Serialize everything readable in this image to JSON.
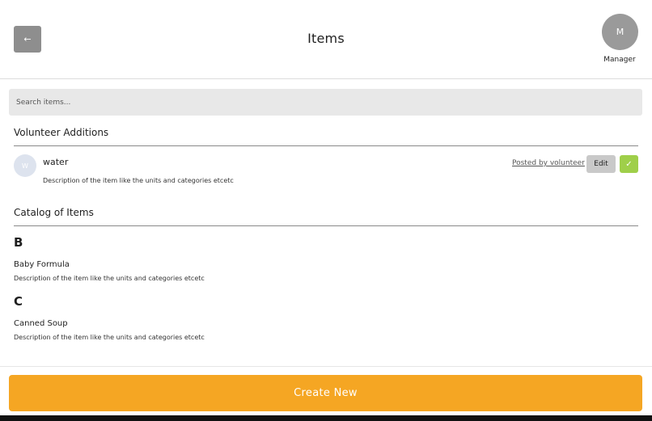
{
  "header": {
    "back_icon": "←",
    "title": "Items",
    "avatar_initial": "M",
    "role_label": "Manager"
  },
  "search": {
    "placeholder": "Search items..."
  },
  "volunteer_section": {
    "title": "Volunteer Additions",
    "items": [
      {
        "avatar_initial": "W",
        "name": "water",
        "description": "Description of the item like the units and categories etcetc",
        "posted_label": "Posted by volunteer",
        "edit_label": "Edit",
        "approve_icon": "✓"
      }
    ]
  },
  "catalog_section": {
    "title": "Catalog of Items",
    "groups": [
      {
        "letter": "B",
        "items": [
          {
            "name": "Baby Formula",
            "description": "Description of the item like the units and categories etcetc"
          }
        ]
      },
      {
        "letter": "C",
        "items": [
          {
            "name": "Canned Soup",
            "description": "Description of the item like the units and categories etcetc"
          }
        ]
      }
    ]
  },
  "footer": {
    "create_label": "Create New"
  },
  "colors": {
    "accent": "#f5a623",
    "approve": "#9fcf4a",
    "back_button": "#8e8e8e",
    "avatar": "#9a9a9a"
  }
}
